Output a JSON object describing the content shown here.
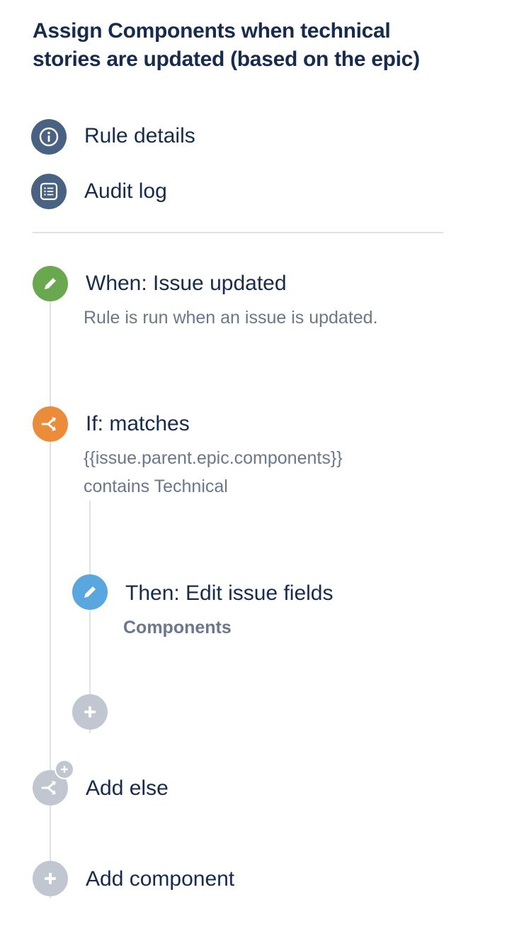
{
  "title": "Assign Components when technical stories are updated (based on the epic)",
  "nav": {
    "rule_details": "Rule details",
    "audit_log": "Audit log"
  },
  "trigger": {
    "heading": "When: Issue updated",
    "description": "Rule is run when an issue is updated."
  },
  "condition": {
    "heading": "If: matches",
    "line1": "{{issue.parent.epic.components}}",
    "line2": "contains Technical"
  },
  "action": {
    "heading": "Then: Edit issue fields",
    "field": "Components"
  },
  "add_else": "Add else",
  "add_component": "Add component",
  "colors": {
    "nav_icon_bg": "#4a6281",
    "trigger_green": "#6aa84f",
    "condition_orange": "#eb8c3a",
    "action_blue": "#5aa7e0",
    "inactive_gray": "#c1c7d0",
    "line_gray": "#dfe1e6"
  }
}
